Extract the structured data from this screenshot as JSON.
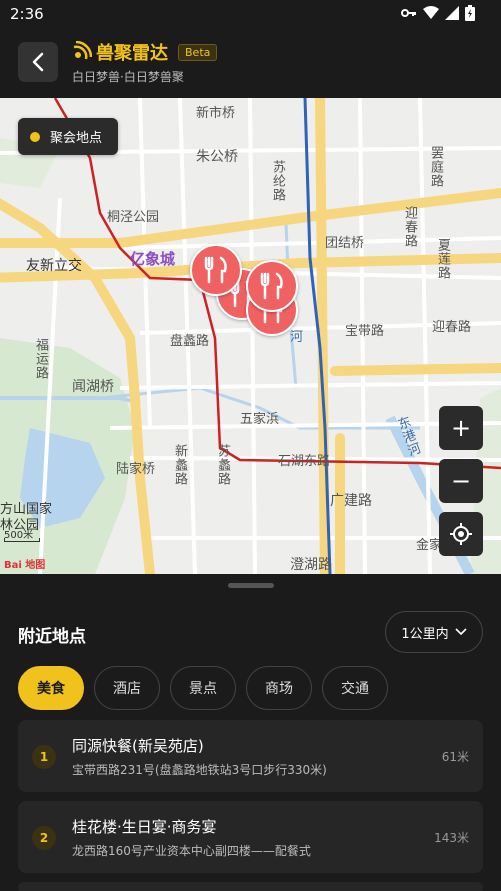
{
  "status": {
    "time": "2:36"
  },
  "header": {
    "title": "兽聚雷达",
    "badge": "Beta",
    "subtitle": "白日梦兽·白日梦兽聚"
  },
  "map": {
    "gather_chip": "聚会地点",
    "labels": {
      "xinshiqiao": "新市桥",
      "zhugongqiao": "朱公桥",
      "tongjinggongyuan": "桐泾公园",
      "yixiangcheng": "亿象城",
      "youxinlijiao": "友新立交",
      "tuanjieqiao": "团结桥",
      "baodailu": "宝带路",
      "yingchunlu_h": "迎春路",
      "panlilu": "盘蠡路",
      "wenhuqiao": "闻湖桥",
      "wujiabang": "五家浜",
      "shihudonglu": "石湖东路",
      "lujiaqiao": "陆家桥",
      "guangjianlu": "广建路",
      "chenghulu": "澄湖路",
      "shangfangshan": "方山国家",
      "linggongyuan": "林公园",
      "jinjiacun": "金家村",
      "sulunlu": "苏纶路",
      "yingchunlu_v": "迎春路",
      "xialianlu": "夏莲路",
      "longtinglu": "罢庭路",
      "fuyunlu": "福运路",
      "xinlilu": "新蠡路",
      "sulilu": "苏蠡路",
      "donggangehe": "东港河",
      "he": "河",
      "wanshan": "宝"
    },
    "scale": "500米",
    "logo": "Bai 地图",
    "zoom_in": "+",
    "zoom_out": "−"
  },
  "sheet": {
    "section_title": "附近地点",
    "range": "1公里内",
    "filters": [
      "美食",
      "酒店",
      "景点",
      "商场",
      "交通"
    ],
    "active_filter": "美食",
    "places": [
      {
        "index": "1",
        "name": "同源快餐(新吴苑店)",
        "address": "宝带西路231号(盘蠡路地铁站3号口步行330米)",
        "distance": "61米"
      },
      {
        "index": "2",
        "name": "桂花楼·生日宴·商务宴",
        "address": "龙西路160号产业资本中心副四楼——配餐式",
        "distance": "143米"
      }
    ]
  },
  "colors": {
    "accent": "#f2c21c",
    "pin": "#f06262",
    "metro": "#cc2222",
    "metro_blue": "#2f63b8"
  }
}
